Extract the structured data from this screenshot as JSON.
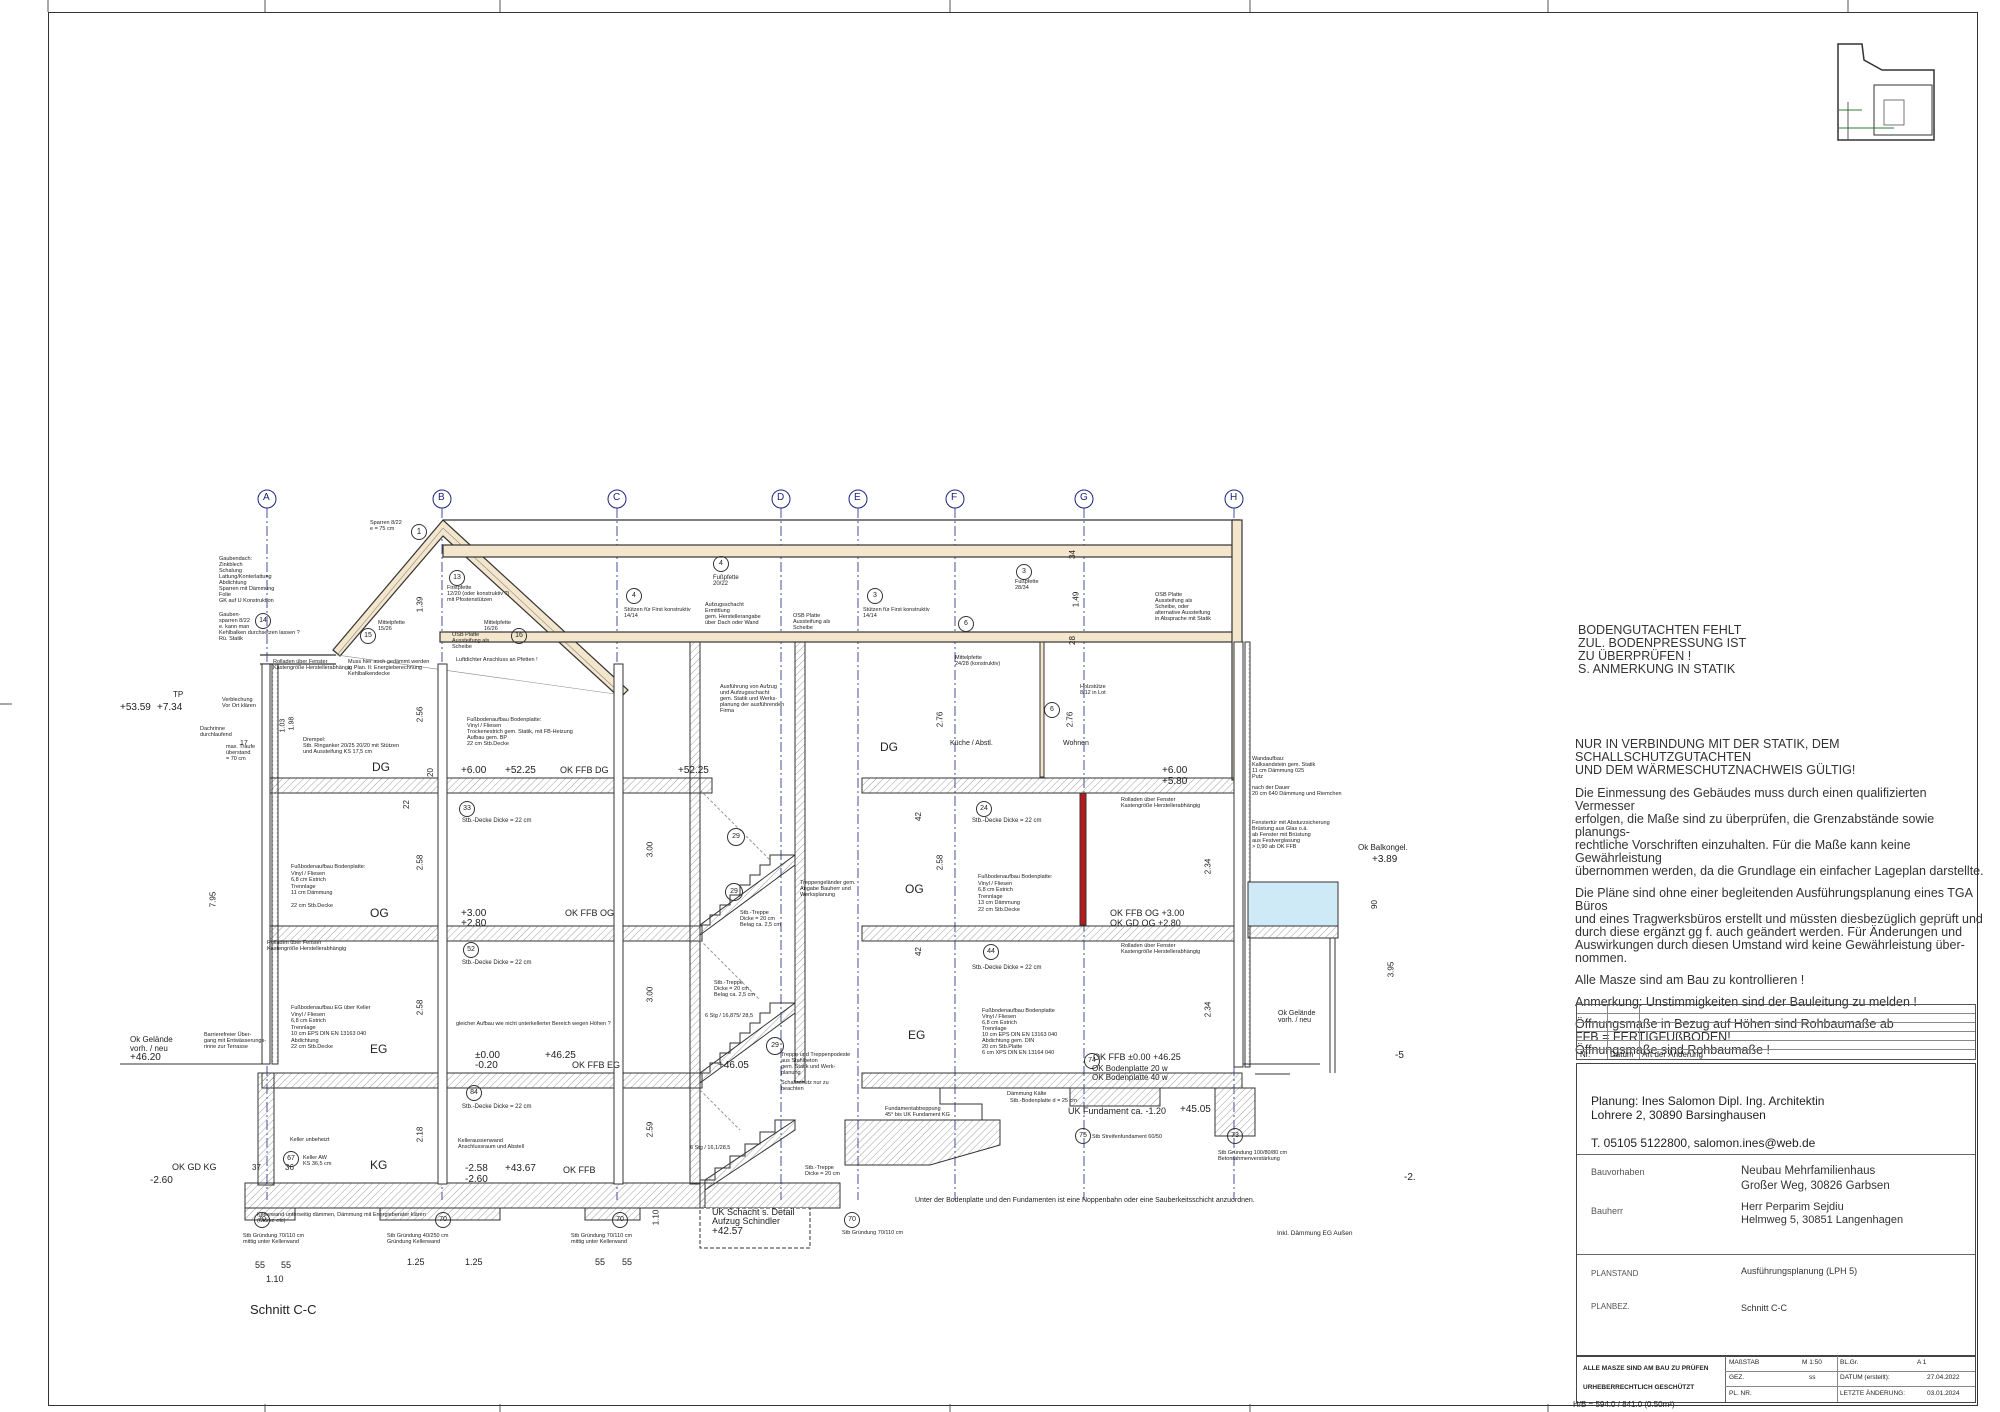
{
  "drawing": {
    "section_title": "Schnitt C-C",
    "axes": [
      "A",
      "B",
      "C",
      "D",
      "E",
      "F",
      "G",
      "H"
    ],
    "storeys": [
      "DG",
      "OG",
      "EG",
      "KG",
      "DG",
      "OG",
      "EG"
    ],
    "levels": {
      "dg_left": "+6.00",
      "dg_abs": "+52.25",
      "ok_ffb_dg": "OK FFB DG",
      "og_left": "+3.00",
      "og_left2": "+2.80",
      "ok_ffb_og": "OK FFB OG",
      "eg_left": "±0.00",
      "eg_left2": "-0.20",
      "eg_abs": "+46.25",
      "ok_ffb_eg": "OK FFB EG",
      "kg_left": "-2.58",
      "kg_abs": "+43.67",
      "ok_ffb_kg": "OK FFB",
      "kg_left2": "-2.60",
      "ok_gd_kg": "OK GD KG",
      "ok_gd_kg_val": "-2.60",
      "tp": "TP",
      "tp_val": "+53.59",
      "tp_rel": "+7.34",
      "gelaende_left": "Ok Gelände\nvorh. / neu",
      "gelaende_left_val": "+46.20",
      "gelaende_right": "Ok Gelände\nvorh. / neu",
      "balkongel": "Ok Balkongel.",
      "balkongel_val": "+3.89",
      "right_dg": "+6.00",
      "right_dg2": "+5.80",
      "right_og": "OK FFB OG  +3.00",
      "right_og2": "OK GD OG  +2.80",
      "right_eg": "OK FFB   ±0.00  +46.25",
      "uk_fundament": "UK Fundament ca.   -1.20",
      "uk_fundament_abs": "+45.05",
      "aufzug": "UK Schacht s. Detail\nAufzug Schindler",
      "aufzug_abs": "+42.57",
      "d_level": "+52.25",
      "d_eg": "+46.05"
    },
    "rooms": {
      "kueche": "Küche / Abstl.",
      "wohnen": "Wohnen"
    },
    "labels": {
      "dg_ceiling_note": "Luftdichter Anschluss an Pfetten !",
      "stb_decke_og": "Stb.-Decke Dicke = 22 cm",
      "stb_decke_eg": "Stb.-Decke Dicke = 22 cm",
      "stb_decke_kg": "Stb.-Decke Dicke = 22 cm",
      "stb_decke_right_og": "Stb.-Decke Dicke = 22 cm",
      "stb_decke_right_eg": "Stb.-Decke Dicke = 22 cm",
      "fusspfette": "Fußpfette\n20/22",
      "firstpfette": "Firstpfette\n12/20",
      "stuetzen": "Stützen für First konstruktiv\n14/14",
      "stuetzen_right": "Stützen für First konstruktiv\n14/14",
      "osb": "OSB Platte\nAussteifung als\nScheibe",
      "osb_right": "OSB Platte\nAussteifung als\nScheibe, oder\nalternative Aussteifung\nin Absprache mit Statik",
      "aufzugschacht": "Aufzugsschacht\nErmittlung\ngem. Herstellerangabe\nüber Dach oder Wand",
      "mittelpfette_right": "Mittelpfette\n24/28 (konstruktiv)",
      "fusspfette_right": "Fußpfette\n28/34",
      "sparren": "Sparren 8/22\ne = 75 cm",
      "ausfuehrung_aufzug": "Ausführung von Aufzug\nund Aufzugsschacht\ngem. Statik und Werks-\nplanung der ausführenden\nFirma",
      "treppe_og": "Stb.-Treppe\nDicke = 20 cm\nBelag ca. 2,5 cm",
      "treppe_eg": "Stb.-Treppe\nDicke = 20 cm\nBelag ca. 2,5 cm",
      "treppe_kg": "Stb.-Treppe\nDicke = 20 cm",
      "stg_eg": "6 Stg / 16,875/ 28,5",
      "stg_kg": "6 Stg / 16,1/28,5",
      "treppengelaender": "Treppengeländer gem.\nAngabe Bauherr und\nWerksplanung",
      "treppenpodest": "Treppe und Treppenpodeste\naus Stahlbeton\ngem. Statik und Werk-\nplanung",
      "schallschutz": "Schallschutz nur zu\nbeachten",
      "fundamente_note": "Unter der Bodenplatte und den Fundamenten ist eine Noppenbahn oder eine Sauberkeitsschicht anzuordnen.",
      "daemmung_eg": "Inkl. Dämmung EG Außen",
      "streifenfundament": "Stb Streifenfundament 60/50",
      "gruendung_left": "Stb Gründung 70/110 cm\nmittig unter Kellerwand",
      "gruendung_mid": "Stb Gründung 40/250 cm\nGründung Kellerwand",
      "gruendung_mid2": "Stb Gründung 70/110 cm\nmittig unter Kellerwand",
      "gruendung_right": "Stb Gründung 70/110 cm",
      "gruendung_far": "Stb Gründung 100/80/80 cm\nBetonrahmenverstärkung",
      "fundamentabtreppung": "Fundamentabtreppung\n45° bis UK Fundament KG",
      "kelleraussenwand": "Kelleraussenwand\nAnschlussraum und Abstell",
      "keller": "Keller unbeheizt",
      "keller_aw": "Keller AW\nKS 36,5 cm",
      "daemmung": "Dämmung Kälte",
      "bodenplatte": "Stb.-Bodenplatte d = 25 cm",
      "ok_bodenplatte": "OK Bodenplatte 20 w",
      "ok_bodenplatte2": "OK Bodenplatte 40 w",
      "fussboden_dg": "Fußbodenaufbau Bodenplatte:\nVinyl / Fliesen\nTrockenestrich gem. Statik, mit FB-Heizung\nAufbau gem. BP\n22 cm  Stb.Decke",
      "fussboden_og": "Fußbodenaufbau Bodenplatte:\nVinyl / Fliesen\n6,8 cm Estrich\nTrennlage\n11 cm  Dämmung\n\n22 cm  Stb.Decke",
      "fussboden_eg": "Fußbodenaufbau EG über Keller\nVinyl / Fliesen\n6,8 cm Estrich\nTrennlage\n10 cm  EPS  DIN EN 13163 040\nAbdichtung\n22 cm  Stb.Decke",
      "fussboden_right_og": "Fußbodenaufbau Bodenplatte:\nVinyl / Fliesen\n6,8 cm Estrich\nTrennlage\n13 cm  Dämmung\n22 cm Stb.Decke",
      "fussboden_right_eg": "Fußbodenaufbau Bodenplatte\nVinyl / Fliesen\n6,8 cm Estrich\nTrennlage\n10 cm  EPS  DIN EN 13163 040\nAbdichtung gem. DIN\n20 cm  Stb.Platte\n6 cm  XPS  DIN EN 13164 040",
      "rolladen": "Rolladen über Fenster\nKastengröße Herstellerabhängig",
      "rolladen_right": "Rolladen über Fenster\nKastengröße Herstellerabhängig",
      "rolladen_dg": "Rolladen über Fenster\nKastengröße Herstellerabhängig",
      "rolladen_eg": "Rolladen über Fenster\nKastengröße Herstellerabhängig",
      "gauben": "Gaubendach:\nZinkblech\nSchalung\nLattung/Konterlattung\nAbdichtung\nSparren mit Dämmung\nFolie\nGK auf U Konstruktion",
      "gauben_sparren": "Gauben-\nsparren 8/22\ne. kann man\nKehlbalken durchsetzen lassen ?\nRü. Statik",
      "mittelpfette": "Mittelpfette\n15/26",
      "pfette_left": "Firstpfette\n12/20 (oder konstruktiv ?)\nmit Pfostenstützen",
      "mittelpfette2": "Mittelpfette\n16/26",
      "osb_left": "OSB Platte\nAussteifung als\nScheibe",
      "anschluss": "Muss hier auch gedämmt werden\nz. Plan. II: Energieberechnung\nKehlbalkendecke",
      "drempel": "Drempel:\nStb. Ringanker 20/25 20/20 mit Stützen\nund Aussteifung KS 17,5 cm",
      "ueberstand": "Verblechung\nVor Ort klären",
      "dachrinne": "Dachrinne\ndurchlaufend",
      "traufe": "max. Traufe\nüberstand\n= 70 cm",
      "barrierefrei": "Barrierefreier Über-\ngang mit Entwässerungs-\nrinne zur Terrasse",
      "gleichter_aufbau": "gleicher Aufbau wie nicht unterkellerter Bereich wegen Höhen ?",
      "holzstuetze": "Holzstütze\n8/12 in Lot",
      "wandaufbau": "Wandaufbau:\nKalksandstein gem. Statik\n11 cm Dämmung 025\nPutz",
      "nach_statik": "nach der Dauer\n20 cm 640 Dämmung und Riemchen",
      "fensterbrueestung": "Fenstertür mit Absturzsicherung\nBrüstung aus Glas o.ä.\nab Fenster mit Brüstung\naus Festverglasung\n> 0,90 ab OK FFB",
      "kellerwand": "Kellerwand unterseitig dämmen, Dämmung mit Energieberater klären\n(Stärke etc)"
    },
    "markers": [
      "1",
      "13",
      "14",
      "15",
      "16",
      "4",
      "3",
      "4",
      "3",
      "6",
      "6",
      "33",
      "29",
      "24",
      "52",
      "29",
      "44",
      "84",
      "29",
      "67",
      "74",
      "75",
      "73",
      "70",
      "70",
      "70",
      "70"
    ],
    "dims": {
      "d1": "1.39",
      "d2": "2.56",
      "d3": "2.58",
      "d4": "2.58",
      "d5": "2.18",
      "d6": "22",
      "d7": "20",
      "d8": "3.00",
      "d9": "3.00",
      "d10": "2.59",
      "d11": "2.76",
      "d12": "2.58",
      "d13": "2.76",
      "d14": "2.34",
      "d15": "2.34",
      "d16": "7.95",
      "d17": "3.95",
      "d18": "1.10",
      "d19": "1.25",
      "d20": "1.25",
      "d21": "55",
      "d22": "55",
      "d23": "55",
      "d24": "55",
      "d25": "1.10",
      "d26": "1.49",
      "d27": "34",
      "d28": "28",
      "d29": "42",
      "d30": "42",
      "d31": "37",
      "d32": "36",
      "d33": "-5",
      "d34": "-2.",
      "d35": "17",
      "d36": "1.03",
      "d37": "1.98",
      "d38": "90"
    },
    "lines": {
      "f1": "+52.25",
      "minus5": "-5"
    }
  },
  "notes": {
    "warning": "BODENGUTACHTEN FEHLT\nZUL. BODENPRESSUNG IST\nZU ÜBERPRÜFEN !\nS. ANMERKUNG IN STATIK",
    "title": "NUR IN VERBINDUNG MIT DER STATIK, DEM SCHALLSCHUTZGUTACHTEN\nUND DEM WÄRMESCHUTZNACHWEIS GÜLTIG!",
    "p1": "Die Einmessung des Gebäudes muss durch einen qualifizierten Vermesser\nerfolgen, die Maße sind zu überprüfen, die Grenzabstände sowie planungs-\nrechtliche Vorschriften einzuhalten. Für die Maße kann keine Gewährleistung\nübernommen werden, da die Grundlage ein einfacher Lageplan darstellte.",
    "p2": "Die Pläne sind ohne einer begleitenden Ausführungsplanung eines TGA Büros\nund eines Tragwerksbüros erstellt und müssten diesbezüglich geprüft und\ndurch diese ergänzt gg f. auch geändert werden. Für Änderungen und\nAuswirkungen durch diesen Umstand wird keine Gewährleistung über-\nnommen.",
    "p3": "Alle Masze sind am Bau zu kontrollieren !",
    "p4": "Anmerkung: Unstimmigkeiten sind der Bauleitung zu melden !",
    "p5": "Öffnungsmaße in Bezug auf Höhen sind Rohbaumaße ab\nFFB = FERTIGFUßBODEN!\nÖffnungsmaße sind Rohbaumaße !"
  },
  "revision": {
    "col_nr": "Nr.",
    "col_datum": "Datum",
    "col_art": "Art der Änderung"
  },
  "titleblock": {
    "planer": "Planung: Ines Salomon Dipl. Ing. Architektin\nLohrere 2, 30890  Barsinghausen\n\nT. 05105 5122800, salomon.ines@web.de",
    "bauvorhaben_label": "Bauvorhaben",
    "bauvorhaben": "Neubau Mehrfamilienhaus\nGroßer Weg, 30826 Garbsen",
    "bauherr_label": "Bauherr",
    "bauherr": "Herr Perparim Sejdiu\nHelmweg 5, 30851 Langenhagen",
    "planstand_label": "PLANSTAND",
    "planstand": "Ausführungsplanung (LPH 5)",
    "planbez_label": "PLANBEZ.",
    "planbez": "Schnitt C-C",
    "massstab_label": "MAßSTAB",
    "massstab": "M 1:50",
    "bl_gr_label": "BL.Gr.",
    "bl_gr": "A 1",
    "gez_label": "GEZ.",
    "gez": "ss",
    "datum_label": "DATUM (erstellt):",
    "datum": "27.04.2022",
    "pl_nr_label": "PL. NR.",
    "letzte_label": "LETZTE ÄNDERUNG:",
    "letzte": "03.01.2024",
    "alle_masze": "ALLE MASZE SIND AM BAU ZU PRÜFEN",
    "urheber": "URHEBERRECHTLICH GESCHÜTZT"
  },
  "footer": {
    "format": "H/B = 594.0 / 841.0 (0.50m²)"
  },
  "colors": {
    "line": "#333333",
    "axis": "#1a237e",
    "wood": "#c8a060",
    "concrete": "#888888",
    "glass": "#cfeaf7",
    "red": "#b71c1c"
  }
}
